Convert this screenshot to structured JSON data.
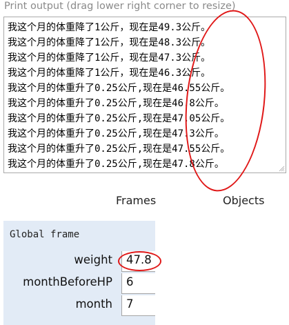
{
  "print_output": {
    "header": "Print output (drag lower right corner to resize)",
    "lines": [
      "我这个月的体重降了1公斤，现在是49.3公斤。",
      "我这个月的体重降了1公斤，现在是48.3公斤。",
      "我这个月的体重降了1公斤，现在是47.3公斤。",
      "我这个月的体重降了1公斤，现在是46.3公斤。",
      "我这个月的体重升了0.25公斤,现在是46.55公斤。",
      "我这个月的体重升了0.25公斤,现在是46.8公斤。",
      "我这个月的体重升了0.25公斤,现在是47.05公斤。",
      "我这个月的体重升了0.25公斤,现在是47.3公斤。",
      "我这个月的体重升了0.25公斤,现在是47.55公斤。",
      "我这个月的体重升了0.25公斤,现在是47.8公斤。"
    ]
  },
  "visualizer": {
    "frames_title": "Frames",
    "objects_title": "Objects"
  },
  "global_frame": {
    "name": "Global frame",
    "variables": [
      {
        "name": "weight",
        "value": "47.8"
      },
      {
        "name": "monthBeforeHP",
        "value": "6"
      },
      {
        "name": "month",
        "value": "7"
      }
    ]
  },
  "annotations": {
    "color": "#e01818"
  }
}
